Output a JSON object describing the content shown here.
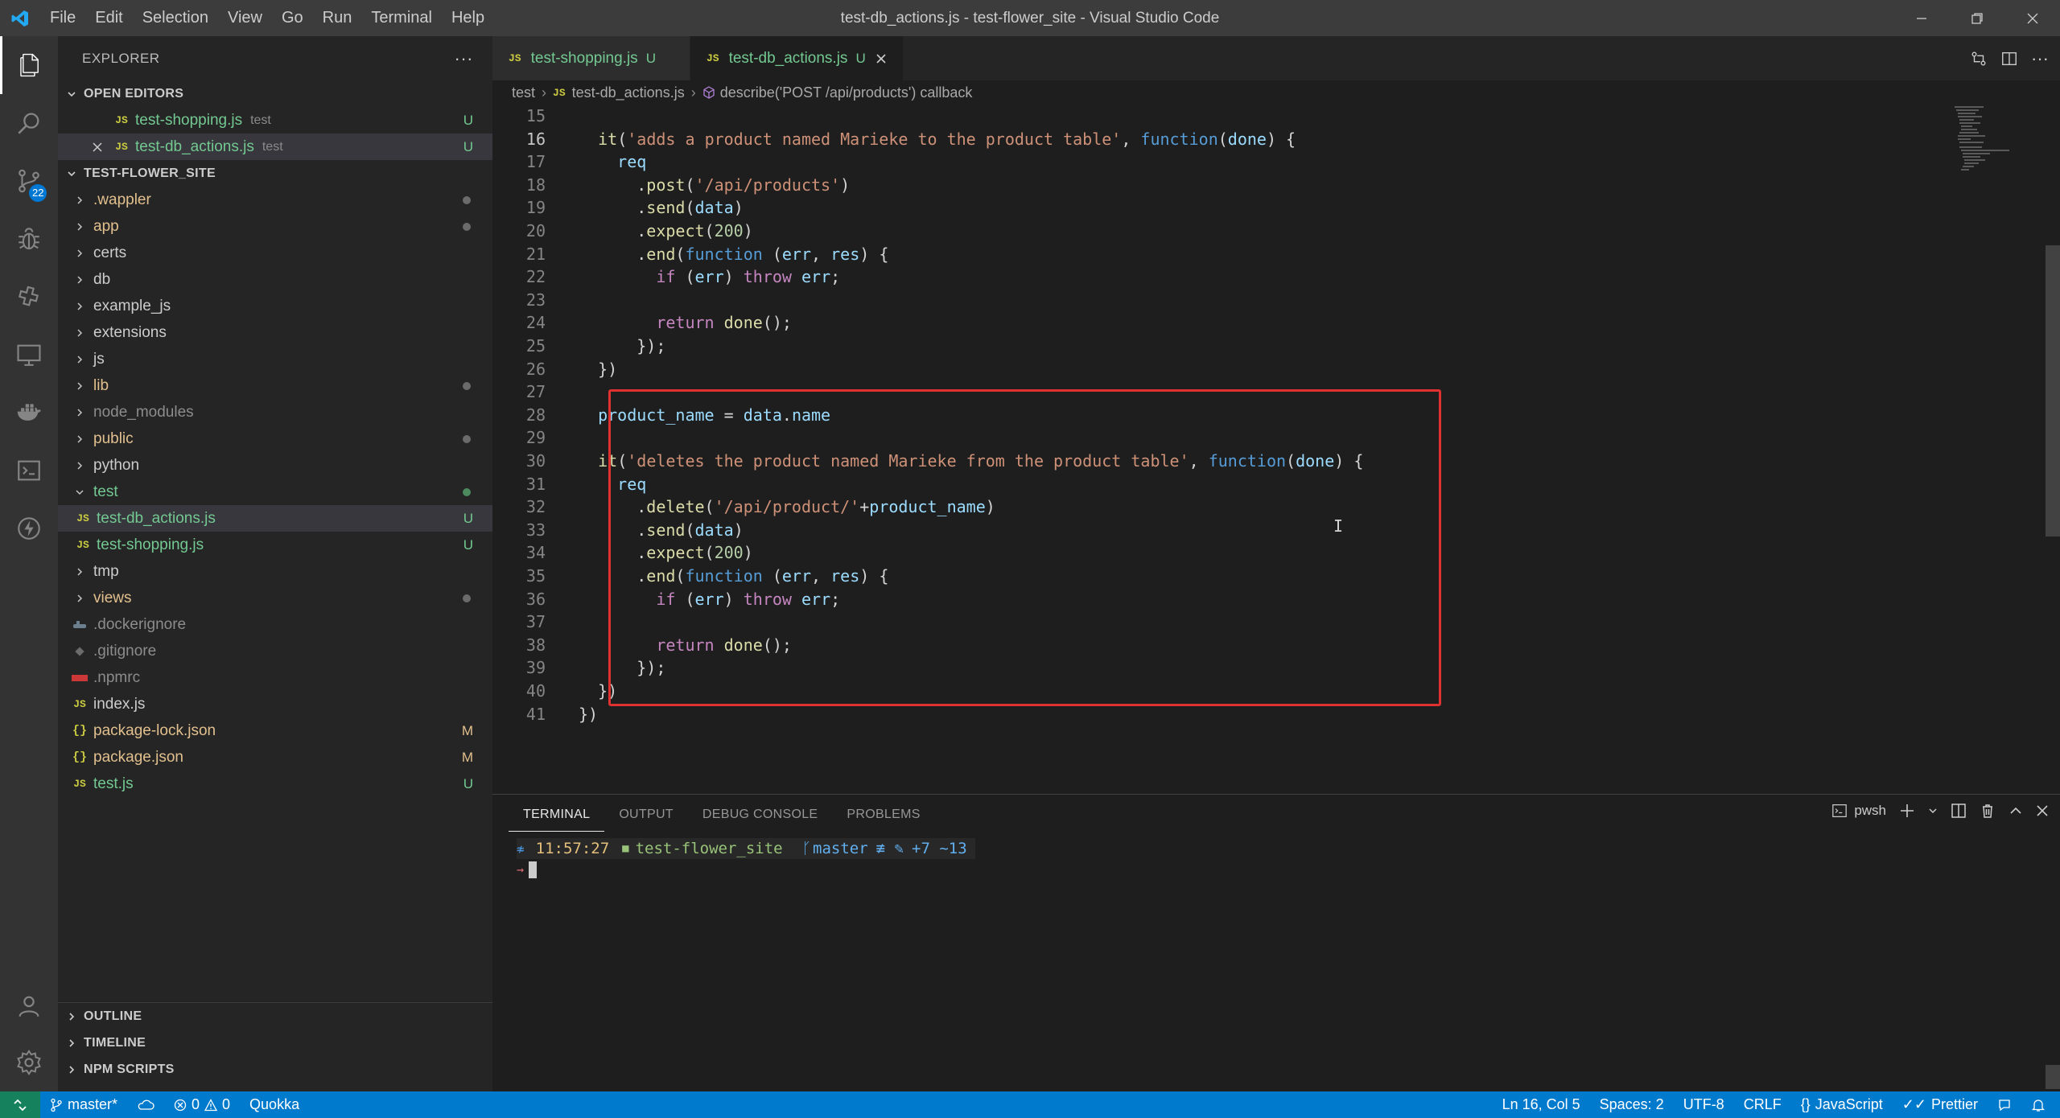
{
  "window": {
    "title": "test-db_actions.js - test-flower_site - Visual Studio Code",
    "menu": [
      "File",
      "Edit",
      "Selection",
      "View",
      "Go",
      "Run",
      "Terminal",
      "Help"
    ]
  },
  "activity": {
    "scm_badge": "22"
  },
  "explorer": {
    "title": "EXPLORER",
    "more": "···",
    "open_editors": {
      "label": "OPEN EDITORS",
      "items": [
        {
          "name": "test-shopping.js",
          "desc": "test",
          "status": "U"
        },
        {
          "name": "test-db_actions.js",
          "desc": "test",
          "status": "U"
        }
      ]
    },
    "workspace": {
      "label": "TEST-FLOWER_SITE",
      "items": [
        {
          "name": ".wappler",
          "status": "dot"
        },
        {
          "name": "app",
          "status": "dot"
        },
        {
          "name": "certs",
          "status": ""
        },
        {
          "name": "db",
          "status": ""
        },
        {
          "name": "example_js",
          "status": ""
        },
        {
          "name": "extensions",
          "status": ""
        },
        {
          "name": "js",
          "status": ""
        },
        {
          "name": "lib",
          "status": "dot"
        },
        {
          "name": "node_modules",
          "status": ""
        },
        {
          "name": "public",
          "status": "dot"
        },
        {
          "name": "python",
          "status": ""
        },
        {
          "name": "test",
          "status": "greendot"
        },
        {
          "name": "test-db_actions.js",
          "status": "U"
        },
        {
          "name": "test-shopping.js",
          "status": "U"
        },
        {
          "name": "tmp",
          "status": ""
        },
        {
          "name": "views",
          "status": "dot"
        },
        {
          "name": ".dockerignore",
          "status": ""
        },
        {
          "name": ".gitignore",
          "status": ""
        },
        {
          "name": ".npmrc",
          "status": ""
        },
        {
          "name": "index.js",
          "status": ""
        },
        {
          "name": "package-lock.json",
          "status": "M"
        },
        {
          "name": "package.json",
          "status": "M"
        },
        {
          "name": "test.js",
          "status": "U"
        }
      ]
    },
    "outline": "OUTLINE",
    "timeline": "TIMELINE",
    "npm_scripts": "NPM SCRIPTS"
  },
  "tabs": [
    {
      "label": "test-shopping.js",
      "status": "U",
      "icon": "JS"
    },
    {
      "label": "test-db_actions.js",
      "status": "U",
      "icon": "JS"
    }
  ],
  "breadcrumb": {
    "folder": "test",
    "file": "test-db_actions.js",
    "symbol": "describe('POST /api/products') callback"
  },
  "code": {
    "line_numbers": [
      "15",
      "16",
      "17",
      "18",
      "19",
      "20",
      "21",
      "22",
      "23",
      "24",
      "25",
      "26",
      "27",
      "28",
      "29",
      "30",
      "31",
      "32",
      "33",
      "34",
      "35",
      "36",
      "37",
      "38",
      "39",
      "40",
      "41"
    ],
    "current_line": "16"
  },
  "panel": {
    "tabs": [
      "TERMINAL",
      "OUTPUT",
      "DEBUG CONSOLE",
      "PROBLEMS"
    ],
    "shell": "pwsh",
    "prompt": {
      "time": "11:57:27",
      "folder": "test-flower_site",
      "branch": "master",
      "git_symbols": "≢ ✎",
      "changes": "+7 ~13",
      "arrow": "→"
    }
  },
  "status": {
    "branch": "master*",
    "errors": "0",
    "warnings": "0",
    "extension": "Quokka",
    "position": "Ln 16, Col 5",
    "spaces": "Spaces: 2",
    "encoding": "UTF-8",
    "eol": "CRLF",
    "language": "JavaScript",
    "formatter": "Prettier"
  },
  "colors": {
    "accent": "#007acc",
    "highlight_box": "#e03131",
    "untracked": "#73c991",
    "modified": "#e2c08d"
  }
}
